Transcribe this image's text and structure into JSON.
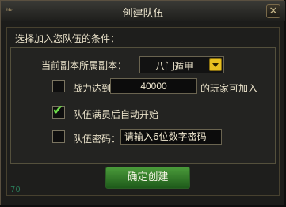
{
  "window": {
    "title": "创建队伍",
    "close_glyph": "✕"
  },
  "conditions": {
    "section_title": "选择加入您队伍的条件：",
    "dungeon": {
      "label": "当前副本所属副本：",
      "selected": "八门遁甲"
    },
    "power": {
      "checked": false,
      "prefix": "战力达到",
      "value": "40000",
      "suffix": "的玩家可加入"
    },
    "auto_start": {
      "checked": true,
      "label": "队伍满员后自动开始"
    },
    "password": {
      "checked": false,
      "label": "队伍密码：",
      "placeholder": "请输入6位数字密码"
    }
  },
  "footer": {
    "confirm_label": "确定创建",
    "corner_value": "70"
  },
  "icons": {
    "close": "close-icon",
    "dropdown": "dropdown-arrow-icon",
    "check": "checkmark-icon"
  },
  "colors": {
    "confirm_button": "#3a8a2e",
    "dropdown_arrow": "#e8c020",
    "checkmark": "#6ee04a"
  }
}
